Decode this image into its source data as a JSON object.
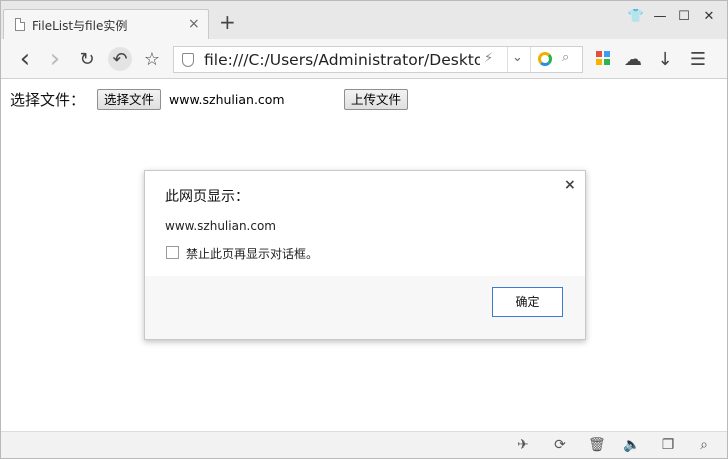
{
  "tab": {
    "title": "FileList与file实例",
    "close_icon": "×"
  },
  "new_tab": "+",
  "window_controls": {
    "skin": "👕",
    "minimize": "—",
    "maximize": "☐",
    "close": "✕"
  },
  "toolbar": {
    "back": "‹",
    "forward": "›",
    "reload": "↻",
    "restore": "↶",
    "star": "☆",
    "address": "file:///C:/Users/Administrator/Desktop",
    "bolt": "⚡",
    "dropdown": "⌄",
    "search": "⌕",
    "cloud": "☁",
    "download": "↓",
    "menu": "☰"
  },
  "page": {
    "label": "选择文件：",
    "choose_button": "选择文件",
    "file_name": "www.szhulian.com",
    "upload_button": "上传文件"
  },
  "dialog": {
    "title": "此网页显示：",
    "close": "×",
    "message": "www.szhulian.com",
    "checkbox_label": "禁止此页再显示对话框。",
    "ok_button": "确定"
  },
  "statusbar": {
    "rocket": "✈",
    "speed": "⟳",
    "trash": "🗑",
    "sound": "🔈",
    "window": "❐",
    "zoom": "⌕"
  }
}
